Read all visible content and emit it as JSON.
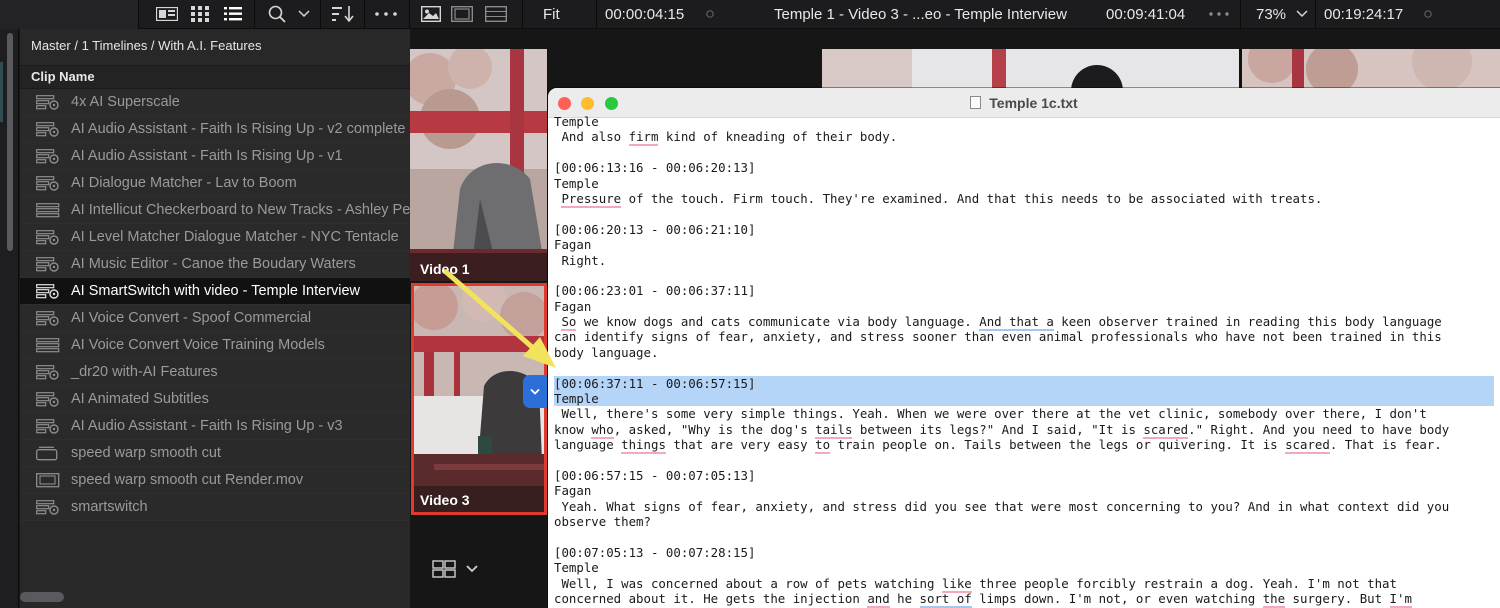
{
  "toolbar": {
    "pool_timecode": "00:00:04:15",
    "fit_label": "Fit",
    "source_timecode": "00:00:04:15",
    "clip_title": "Temple 1 - Video 3 - ...eo - Temple Interview",
    "duration_timecode": "00:09:41:04",
    "zoom_value": "73%",
    "record_timecode": "00:19:24:17"
  },
  "media_pool": {
    "breadcrumb": "Master / 1 Timelines / With A.I. Features",
    "column_header": "Clip Name",
    "clips": [
      {
        "name": "4x AI Superscale",
        "icon": "timeline-icon",
        "selected": false
      },
      {
        "name": "AI Audio Assistant  - Faith Is Rising Up - v2 complete",
        "icon": "timeline-icon",
        "selected": false
      },
      {
        "name": "AI Audio Assistant - Faith Is Rising Up - v1",
        "icon": "timeline-icon",
        "selected": false
      },
      {
        "name": "AI Dialogue Matcher - Lav to Boom",
        "icon": "timeline-icon",
        "selected": false
      },
      {
        "name": "AI Intellicut Checkerboard to New Tracks - Ashley Pe",
        "icon": "multitrack-icon",
        "selected": false
      },
      {
        "name": "AI Level Matcher Dialogue Matcher - NYC Tentacle",
        "icon": "timeline-icon",
        "selected": false
      },
      {
        "name": "AI Music Editor - Canoe the Boudary Waters",
        "icon": "timeline-icon",
        "selected": false
      },
      {
        "name": "AI SmartSwitch with video - Temple Interview",
        "icon": "timeline-icon",
        "selected": true
      },
      {
        "name": "AI Voice Convert - Spoof Commercial",
        "icon": "timeline-icon",
        "selected": false
      },
      {
        "name": "AI Voice Convert Voice Training Models",
        "icon": "multitrack-icon",
        "selected": false
      },
      {
        "name": "_dr20 with-AI Features",
        "icon": "timeline-icon",
        "selected": false
      },
      {
        "name": "AI Animated Subtitles",
        "icon": "timeline-icon",
        "selected": false
      },
      {
        "name": "AI Audio Assistant - Faith Is Rising Up - v3",
        "icon": "timeline-icon",
        "selected": false
      },
      {
        "name": "speed warp smooth cut",
        "icon": "compound-icon",
        "selected": false
      },
      {
        "name": "speed warp smooth cut Render.mov",
        "icon": "film-icon",
        "selected": false
      },
      {
        "name": "smartswitch",
        "icon": "timeline-icon",
        "selected": false
      }
    ]
  },
  "viewer": {
    "angle_1_label": "Video 1",
    "angle_3_label": "Video 3"
  },
  "editor": {
    "title": "Temple 1c.txt",
    "lines": [
      {
        "t": "Temple"
      },
      {
        "t": " And also firm kind of kneading of their body.",
        "u": [
          [
            "firm",
            "r"
          ]
        ]
      },
      {
        "t": ""
      },
      {
        "t": "[00:06:13:16 - 00:06:20:13]"
      },
      {
        "t": "Temple"
      },
      {
        "t": " Pressure of the touch. Firm touch. They're examined. And that this needs to be associated with treats.",
        "u": [
          [
            "Pressure",
            "r"
          ]
        ]
      },
      {
        "t": ""
      },
      {
        "t": "[00:06:20:13 - 00:06:21:10]"
      },
      {
        "t": "Fagan"
      },
      {
        "t": " Right."
      },
      {
        "t": ""
      },
      {
        "t": "[00:06:23:01 - 00:06:37:11]"
      },
      {
        "t": "Fagan"
      },
      {
        "t": " So we know dogs and cats communicate via body language. And that a keen observer trained in reading this body language",
        "u": [
          [
            "So",
            "r"
          ],
          [
            "And that a",
            "b"
          ]
        ]
      },
      {
        "t": "can identify signs of fear, anxiety, and stress sooner than even animal professionals who have not been trained in this"
      },
      {
        "t": "body language."
      },
      {
        "t": ""
      },
      {
        "t": "[00:06:37:11 - 00:06:57:15]",
        "hl": true
      },
      {
        "t": "Temple",
        "hl": true
      },
      {
        "t": " Well, there's some very simple things. Yeah. When we were over there at the vet clinic, somebody over there, I don't"
      },
      {
        "t": "know who, asked, \"Why is the dog's tails between its legs?\" And I said, \"It is scared.\" Right. And you need to have body",
        "u": [
          [
            "who",
            "r"
          ],
          [
            "tails",
            "r"
          ],
          [
            "scared",
            "r"
          ]
        ]
      },
      {
        "t": "language things that are very easy to train people on. Tails between the legs or quivering. It is scared. That is fear.",
        "u": [
          [
            "things",
            "r"
          ],
          [
            "to",
            "r"
          ],
          [
            "scared",
            "r"
          ]
        ]
      },
      {
        "t": ""
      },
      {
        "t": "[00:06:57:15 - 00:07:05:13]"
      },
      {
        "t": "Fagan"
      },
      {
        "t": " Yeah. What signs of fear, anxiety, and stress did you see that were most concerning to you? And in what context did you"
      },
      {
        "t": "observe them?"
      },
      {
        "t": ""
      },
      {
        "t": "[00:07:05:13 - 00:07:28:15]"
      },
      {
        "t": "Temple"
      },
      {
        "t": " Well, I was concerned about a row of pets watching like three people forcibly restrain a dog. Yeah. I'm not that",
        "u": [
          [
            "like",
            "r"
          ]
        ]
      },
      {
        "t": "concerned about it. He gets the injection and he sort of limps down. I'm not, or even watching the surgery. But I'm",
        "u": [
          [
            "and",
            "r"
          ],
          [
            "sort of",
            "b"
          ],
          [
            "the",
            "r"
          ],
          [
            "I'm",
            "r"
          ]
        ]
      }
    ]
  },
  "colors": {
    "selection_highlight": "#b4d4f8",
    "spell_underline": "#f3a9b9",
    "grammar_underline": "#a9c5ef",
    "angle_border": "#e03a2f",
    "arrow": "#f2e35c",
    "cam_switch_button": "#2d6fd8"
  }
}
